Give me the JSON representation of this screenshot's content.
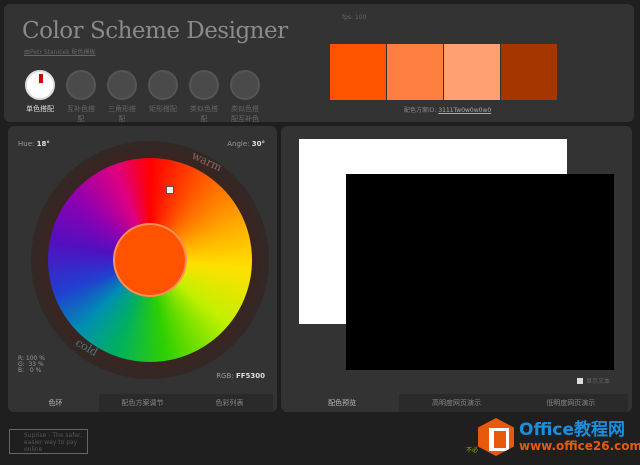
{
  "header": {
    "title": "Color Scheme Designer",
    "subtitle": "由Petr Stanicek 配色模板",
    "fps": "fps: 100"
  },
  "modes": [
    {
      "label": "单色搭配",
      "active": true
    },
    {
      "label": "互补色搭配",
      "active": false
    },
    {
      "label": "三角形搭配",
      "active": false
    },
    {
      "label": "矩形搭配",
      "active": false
    },
    {
      "label": "类似色搭配",
      "active": false
    },
    {
      "label": "类似色搭配互补色",
      "active": false
    }
  ],
  "swatches": [
    "#FF5300",
    "#FF7F40",
    "#FFA073",
    "#A63600"
  ],
  "scheme_id": {
    "label": "配色方案ID:",
    "value": "3111Tw0w0w0w0"
  },
  "wheel": {
    "hue": "18°",
    "hue_label": "Hue:",
    "angle": "30°",
    "angle_label": "Angle:",
    "warm": "warm",
    "cold": "cold",
    "r": "R: 100 %",
    "g": "G:  33 %",
    "b": "B:   0 %",
    "rgb_label": "RGB:",
    "rgb": "FF5300",
    "base_color": "#FF5300"
  },
  "left_tabs": [
    "色环",
    "配色方案调节",
    "色彩列表"
  ],
  "right_tabs": [
    "配色预览",
    "高明度网页演示",
    "低明度网页演示"
  ],
  "preview": {
    "checkbox_label": "显示文本"
  },
  "ad": {
    "alt": "Suprise - The safer, easier way to pay online"
  },
  "note": "不必",
  "watermark": {
    "line1": "Office教程网",
    "line2": "www.office26.com"
  }
}
